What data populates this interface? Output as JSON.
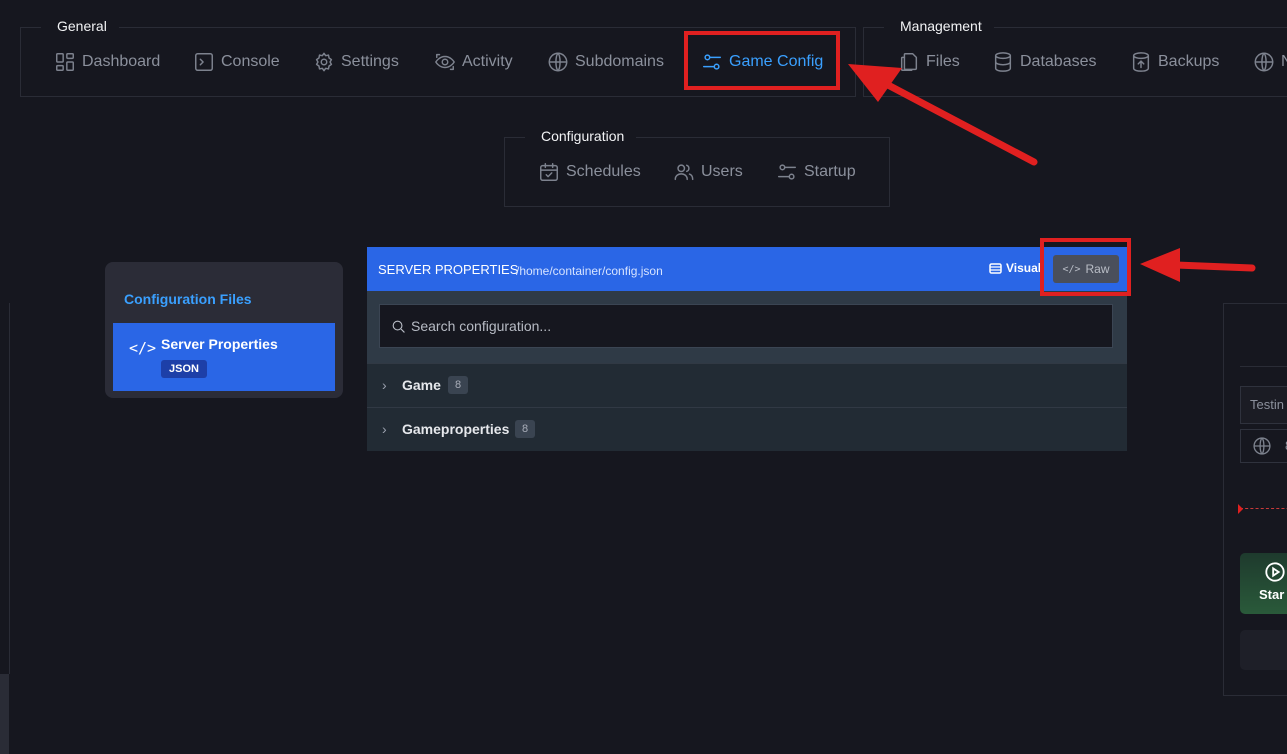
{
  "nav": {
    "general": {
      "label": "General",
      "items": [
        {
          "label": "Dashboard",
          "icon": "dashboard-icon"
        },
        {
          "label": "Console",
          "icon": "console-icon"
        },
        {
          "label": "Settings",
          "icon": "gear-icon"
        },
        {
          "label": "Activity",
          "icon": "eye-icon"
        },
        {
          "label": "Subdomains",
          "icon": "globe-icon"
        },
        {
          "label": "Game Config",
          "icon": "sliders-icon",
          "active": true
        }
      ]
    },
    "management": {
      "label": "Management",
      "items": [
        {
          "label": "Files",
          "icon": "files-icon"
        },
        {
          "label": "Databases",
          "icon": "database-icon"
        },
        {
          "label": "Backups",
          "icon": "backup-icon"
        },
        {
          "label": "N",
          "icon": "globe-icon"
        }
      ]
    },
    "configuration": {
      "label": "Configuration",
      "items": [
        {
          "label": "Schedules",
          "icon": "calendar-icon"
        },
        {
          "label": "Users",
          "icon": "users-icon"
        },
        {
          "label": "Startup",
          "icon": "sliders-icon"
        }
      ]
    }
  },
  "sidebar": {
    "title": "Configuration Files",
    "items": [
      {
        "label": "Server Properties",
        "badge": "JSON",
        "icon": "code-icon"
      }
    ]
  },
  "editor": {
    "title": "SERVER PROPERTIES",
    "path": "/home/container/config.json",
    "visual_label": "Visual",
    "raw_label": "Raw",
    "search_placeholder": "Search configuration...",
    "sections": [
      {
        "name": "Game",
        "count": "8"
      },
      {
        "name": "Gameproperties",
        "count": "8"
      }
    ]
  },
  "right_panel": {
    "input_value": "Testin",
    "address_partial": "8",
    "start_label": "Star"
  },
  "colors": {
    "background": "#16171f",
    "accent": "#3aa0ff",
    "primary": "#2a66e6",
    "annotation": "#e02020"
  }
}
